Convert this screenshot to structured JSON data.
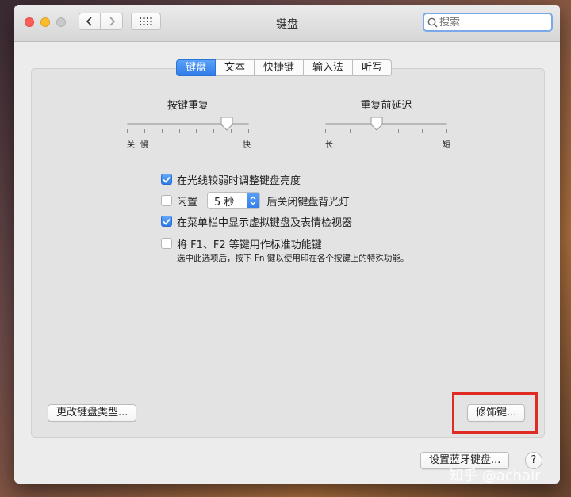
{
  "window": {
    "title": "键盘"
  },
  "search": {
    "placeholder": "搜索"
  },
  "tabs": [
    {
      "label": "键盘",
      "active": true
    },
    {
      "label": "文本",
      "active": false
    },
    {
      "label": "快捷键",
      "active": false
    },
    {
      "label": "输入法",
      "active": false
    },
    {
      "label": "听写",
      "active": false
    }
  ],
  "key_repeat": {
    "title": "按键重复",
    "left_label": "关",
    "left_label2": "慢",
    "right_label": "快",
    "level": 0.82
  },
  "repeat_delay": {
    "title": "重复前延迟",
    "left_label": "长",
    "right_label": "短",
    "level": 0.42
  },
  "options": {
    "brightness": {
      "label": "在光线较弱时调整键盘亮度",
      "checked": true
    },
    "idle": {
      "label": "闲置",
      "checked": false,
      "duration": "5 秒",
      "suffix": "后关闭键盘背光灯"
    },
    "menubar": {
      "label": "在菜单栏中显示虚拟键盘及表情检视器",
      "checked": true
    },
    "fkeys": {
      "label": "将 F1、F2 等键用作标准功能键",
      "checked": false,
      "note": "选中此选项后，按下 Fn 键以使用印在各个按键上的特殊功能。"
    }
  },
  "buttons": {
    "change_keyboard_type": "更改键盘类型...",
    "modifier_keys": "修饰键...",
    "bluetooth_keyboard": "设置蓝牙键盘...",
    "help": "?"
  },
  "watermark": "知乎 @achair",
  "colors": {
    "accent": "#2e7ce9",
    "highlight": "#e02b24"
  }
}
